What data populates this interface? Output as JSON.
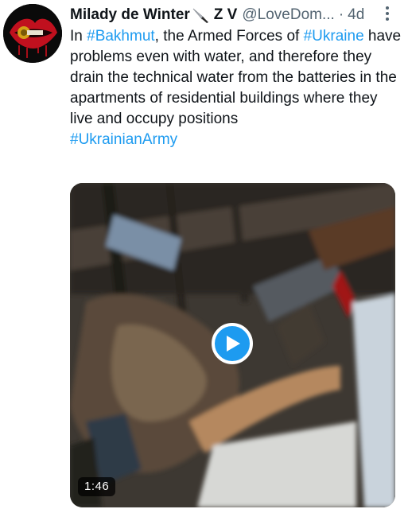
{
  "tweet": {
    "author": {
      "name": "Milady de Winter",
      "suffix": "Z V",
      "handle": "@LoveDom...",
      "separator": "·",
      "time": "4d"
    },
    "text": {
      "line1_prefix": "In ",
      "hashtag_bakhmut": "#Bakhmut",
      "line1_middle": ", the Armed Forces of ",
      "hashtag_ukraine": "#Ukraine",
      "body": " have problems even with water, and therefore they drain the technical water from the batteries in the apartments of residential buildings where they live and occupy positions",
      "hashtag_army": "#UkrainianArmy"
    },
    "media": {
      "duration": "1:46"
    }
  },
  "colors": {
    "link": "#1d9bf0",
    "text": "#0f1419",
    "secondary": "#536471",
    "play_button": "#1d9bf0"
  },
  "icons": {
    "knife": "knife-icon",
    "more": "more-options-icon",
    "play": "play-icon"
  }
}
